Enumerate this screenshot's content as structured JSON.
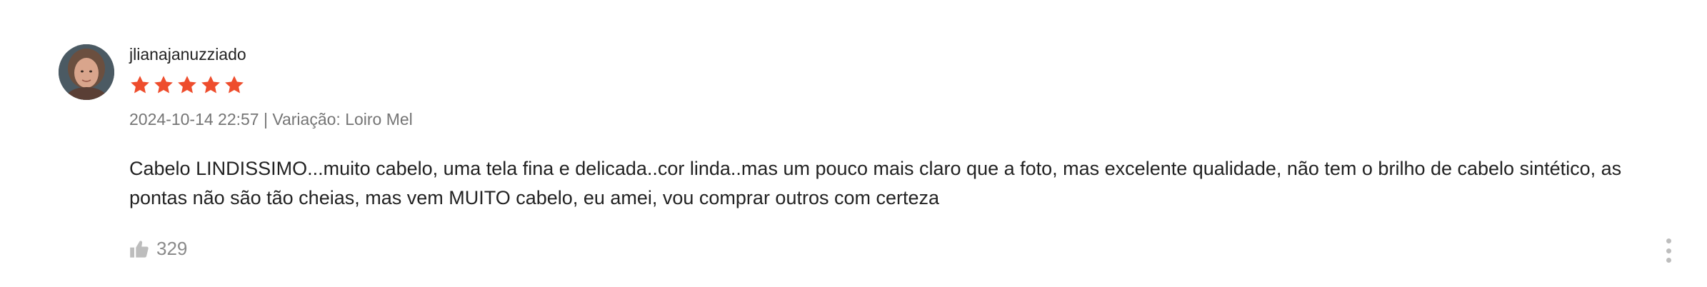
{
  "review": {
    "username": "jlianajanuzziado",
    "rating": 5,
    "rating_max": 5,
    "star_color": "#ee4d2d",
    "date_variation": "2024-10-14 22:57 | Variação: Loiro Mel",
    "comment": "Cabelo LINDISSIMO...muito cabelo, uma tela fina e delicada..cor linda..mas um pouco mais claro que a foto,  mas excelente qualidade, não tem o brilho de cabelo sintético, as pontas não são tão cheias, mas vem MUITO cabelo, eu amei, vou comprar outros com certeza",
    "likes": "329",
    "icons": {
      "like": "thumbs-up-icon",
      "more": "more-vertical-icon"
    }
  }
}
